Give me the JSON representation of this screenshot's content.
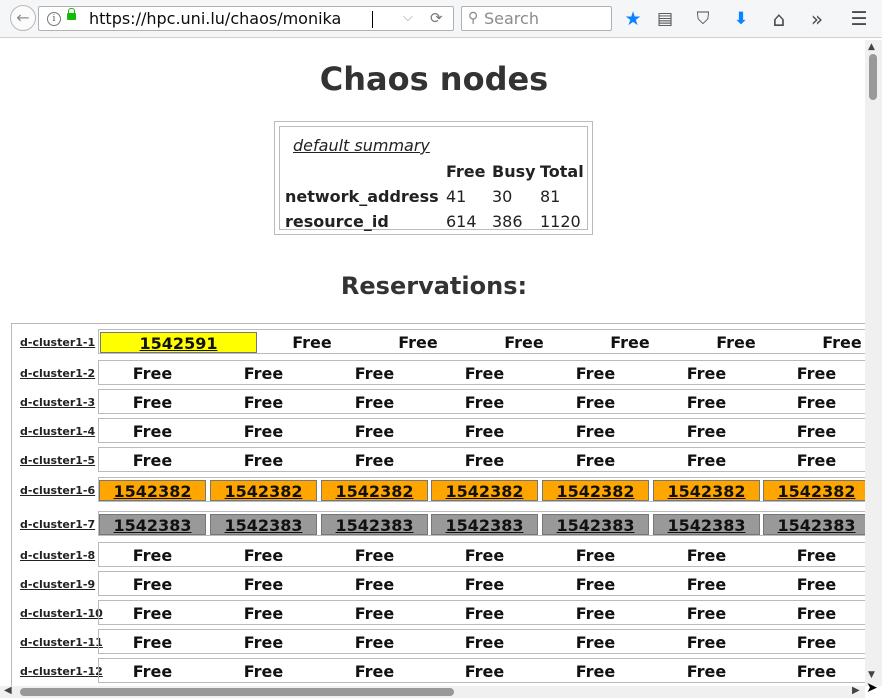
{
  "browser": {
    "url": "https://hpc.uni.lu/chaos/monika",
    "search_placeholder": "Search",
    "back_glyph": "←",
    "reload_glyph": "⟳",
    "dropdown_glyph": "⌵",
    "search_glyph": "⚲",
    "star_glyph": "★",
    "reader_glyph": "▤",
    "pocket_glyph": "⛉",
    "download_glyph": "⬇",
    "home_glyph": "⌂",
    "overflow_glyph": "»",
    "menu_glyph": "☰"
  },
  "page": {
    "title": "Chaos nodes",
    "summary": {
      "caption": "default summary",
      "headers": [
        "Free",
        "Busy",
        "Total"
      ],
      "rows": [
        {
          "label": "network_address",
          "free": "41",
          "busy": "30",
          "total": "81"
        },
        {
          "label": "resource_id",
          "free": "614",
          "busy": "386",
          "total": "1120"
        }
      ]
    },
    "reservations_title": "Reservations:",
    "nodes": [
      {
        "name": "d-cluster1-1",
        "cells": [
          "1542591",
          "Free",
          "Free",
          "Free",
          "Free",
          "Free",
          "Free"
        ]
      },
      {
        "name": "d-cluster1-2",
        "cells": [
          "Free",
          "Free",
          "Free",
          "Free",
          "Free",
          "Free",
          "Free"
        ]
      },
      {
        "name": "d-cluster1-3",
        "cells": [
          "Free",
          "Free",
          "Free",
          "Free",
          "Free",
          "Free",
          "Free"
        ]
      },
      {
        "name": "d-cluster1-4",
        "cells": [
          "Free",
          "Free",
          "Free",
          "Free",
          "Free",
          "Free",
          "Free"
        ]
      },
      {
        "name": "d-cluster1-5",
        "cells": [
          "Free",
          "Free",
          "Free",
          "Free",
          "Free",
          "Free",
          "Free"
        ]
      },
      {
        "name": "d-cluster1-6",
        "cells": [
          "1542382",
          "1542382",
          "1542382",
          "1542382",
          "1542382",
          "1542382",
          "1542382"
        ]
      },
      {
        "name": "d-cluster1-7",
        "cells": [
          "1542383",
          "1542383",
          "1542383",
          "1542383",
          "1542383",
          "1542383",
          "1542383"
        ]
      },
      {
        "name": "d-cluster1-8",
        "cells": [
          "Free",
          "Free",
          "Free",
          "Free",
          "Free",
          "Free",
          "Free"
        ]
      },
      {
        "name": "d-cluster1-9",
        "cells": [
          "Free",
          "Free",
          "Free",
          "Free",
          "Free",
          "Free",
          "Free"
        ]
      },
      {
        "name": "d-cluster1-10",
        "cells": [
          "Free",
          "Free",
          "Free",
          "Free",
          "Free",
          "Free",
          "Free"
        ]
      },
      {
        "name": "d-cluster1-11",
        "cells": [
          "Free",
          "Free",
          "Free",
          "Free",
          "Free",
          "Free",
          "Free"
        ]
      },
      {
        "name": "d-cluster1-12",
        "cells": [
          "Free",
          "Free",
          "Free",
          "Free",
          "Free",
          "Free",
          "Free"
        ]
      }
    ],
    "job_colors": {
      "1542591": "#ffff00",
      "1542382": "#ffa500",
      "1542383": "#999999"
    }
  }
}
